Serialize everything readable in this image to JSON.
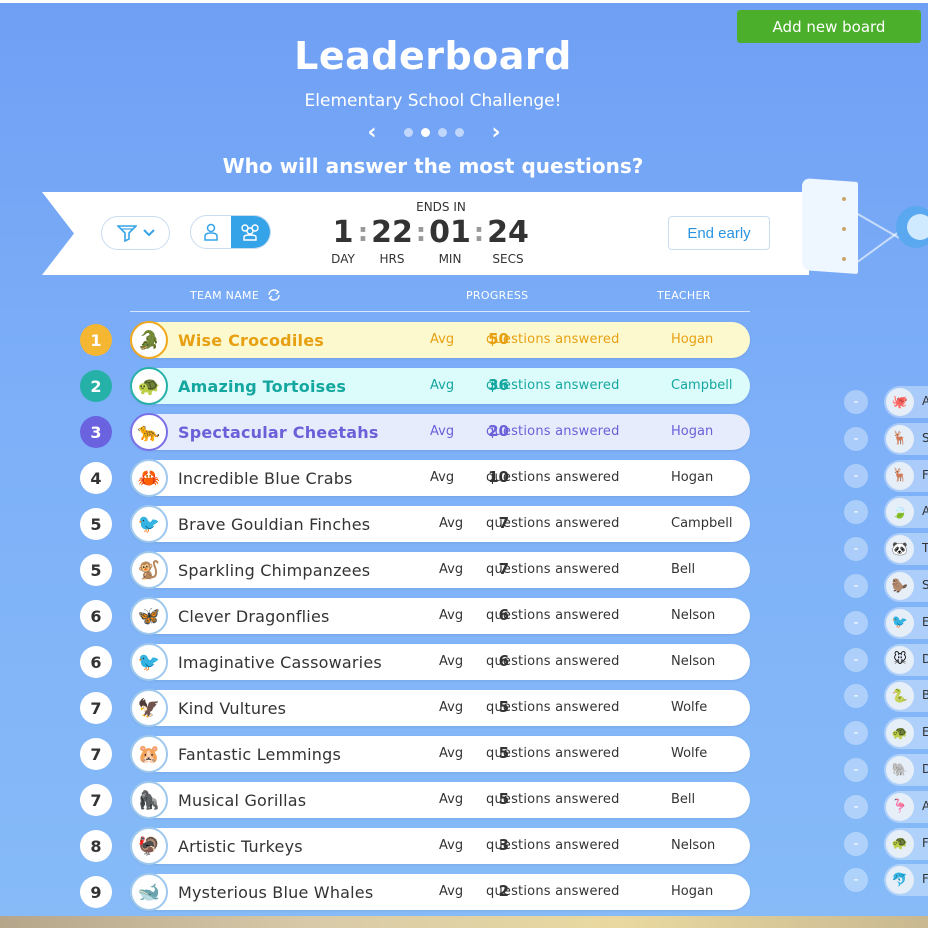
{
  "header": {
    "add_board_label": "Add new board",
    "title": "Leaderboard",
    "subtitle": "Elementary School Challenge!",
    "question": "Who will answer the most questions?",
    "pager": {
      "prev": "‹",
      "next": "›",
      "page_count": 4,
      "active_page": 2
    }
  },
  "timer": {
    "label": "ENDS IN",
    "day": "1",
    "day_label": "DAY",
    "hrs": "22",
    "hrs_label": "HRS",
    "min": "01",
    "min_label": "MIN",
    "secs": "24",
    "secs_label": "SECS",
    "end_early_label": "End early"
  },
  "table": {
    "columns": {
      "team": "TEAM NAME",
      "progress": "PROGRESS",
      "teacher": "TEACHER"
    },
    "avg_label": "Avg",
    "progress_suffix": "questions answered",
    "rows": [
      {
        "rank": "1",
        "name": "Wise Crocodiles",
        "avg": "50",
        "teacher": "Hogan",
        "icon": "🐊"
      },
      {
        "rank": "2",
        "name": "Amazing Tortoises",
        "avg": "36",
        "teacher": "Campbell",
        "icon": "🐢"
      },
      {
        "rank": "3",
        "name": "Spectacular Cheetahs",
        "avg": "20",
        "teacher": "Hogan",
        "icon": "🐆"
      },
      {
        "rank": "4",
        "name": "Incredible Blue Crabs",
        "avg": "10",
        "teacher": "Hogan",
        "icon": "🦀"
      },
      {
        "rank": "5",
        "name": "Brave Gouldian Finches",
        "avg": "7",
        "teacher": "Campbell",
        "icon": "🐦"
      },
      {
        "rank": "5",
        "name": "Sparkling Chimpanzees",
        "avg": "7",
        "teacher": "Bell",
        "icon": "🐒"
      },
      {
        "rank": "6",
        "name": "Clever Dragonflies",
        "avg": "6",
        "teacher": "Nelson",
        "icon": "🦋"
      },
      {
        "rank": "6",
        "name": "Imaginative Cassowaries",
        "avg": "6",
        "teacher": "Nelson",
        "icon": "🐦"
      },
      {
        "rank": "7",
        "name": "Kind Vultures",
        "avg": "5",
        "teacher": "Wolfe",
        "icon": "🦅"
      },
      {
        "rank": "7",
        "name": "Fantastic Lemmings",
        "avg": "5",
        "teacher": "Wolfe",
        "icon": "🐹"
      },
      {
        "rank": "7",
        "name": "Musical Gorillas",
        "avg": "5",
        "teacher": "Bell",
        "icon": "🦍"
      },
      {
        "rank": "8",
        "name": "Artistic Turkeys",
        "avg": "3",
        "teacher": "Nelson",
        "icon": "🦃"
      },
      {
        "rank": "9",
        "name": "Mysterious Blue Whales",
        "avg": "2",
        "teacher": "Hogan",
        "icon": "🐋"
      }
    ]
  },
  "side_list": {
    "minus_label": "-",
    "items": [
      {
        "icon": "🐙",
        "text": "A"
      },
      {
        "icon": "🦌",
        "text": "S"
      },
      {
        "icon": "🦌",
        "text": "F"
      },
      {
        "icon": "🍃",
        "text": "A"
      },
      {
        "icon": "🐼",
        "text": "T"
      },
      {
        "icon": "🦫",
        "text": "S"
      },
      {
        "icon": "🐦",
        "text": "E"
      },
      {
        "icon": "🐭",
        "text": "D"
      },
      {
        "icon": "🐍",
        "text": "B"
      },
      {
        "icon": "🐢",
        "text": "E"
      },
      {
        "icon": "🐘",
        "text": "D"
      },
      {
        "icon": "🦩",
        "text": "A"
      },
      {
        "icon": "🐢",
        "text": "F"
      },
      {
        "icon": "🐬",
        "text": "F"
      }
    ]
  }
}
